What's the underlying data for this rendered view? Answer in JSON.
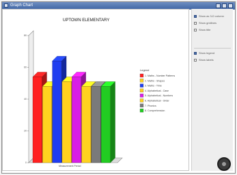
{
  "window": {
    "title": "Graph Chart"
  },
  "options": [
    {
      "label": "Show as 3-D column",
      "checked": true
    },
    {
      "label": "Show gridlines",
      "checked": false
    },
    {
      "label": "Show title",
      "checked": false
    },
    {
      "label": "Show legend",
      "checked": true
    },
    {
      "label": "Show labels",
      "checked": false
    }
  ],
  "chart_data": {
    "type": "bar",
    "title": "UPTOWN ELEMENTARY",
    "xlabel": "Measurement Period",
    "ylabel": "",
    "ylim": [
      0,
      80
    ],
    "ticks": [
      "80",
      "60",
      "40",
      "20",
      "0"
    ],
    "legend_title": "Legend",
    "legend_position": "right",
    "categories": [
      ""
    ],
    "series": [
      {
        "name": "1. Maths - Number Patterns",
        "values": [
          54
        ],
        "color": "#ff2020"
      },
      {
        "name": "2. Maths - Shapes",
        "values": [
          48
        ],
        "color": "#ffd21f"
      },
      {
        "name": "3. Maths - Time",
        "values": [
          64
        ],
        "color": "#1f3df0"
      },
      {
        "name": "4. Alphabetical - Case",
        "values": [
          51
        ],
        "color": "#ffd21f"
      },
      {
        "name": "5. Alphabetical - Numbers",
        "values": [
          54
        ],
        "color": "#d91ee6"
      },
      {
        "name": "6. Alphabetical - Order",
        "values": [
          48
        ],
        "color": "#ffd21f"
      },
      {
        "name": "7. Phonics",
        "values": [
          48
        ],
        "color": "#7a7a7a"
      },
      {
        "name": "8. Comprehension",
        "values": [
          48
        ],
        "color": "#22cc22"
      }
    ]
  }
}
